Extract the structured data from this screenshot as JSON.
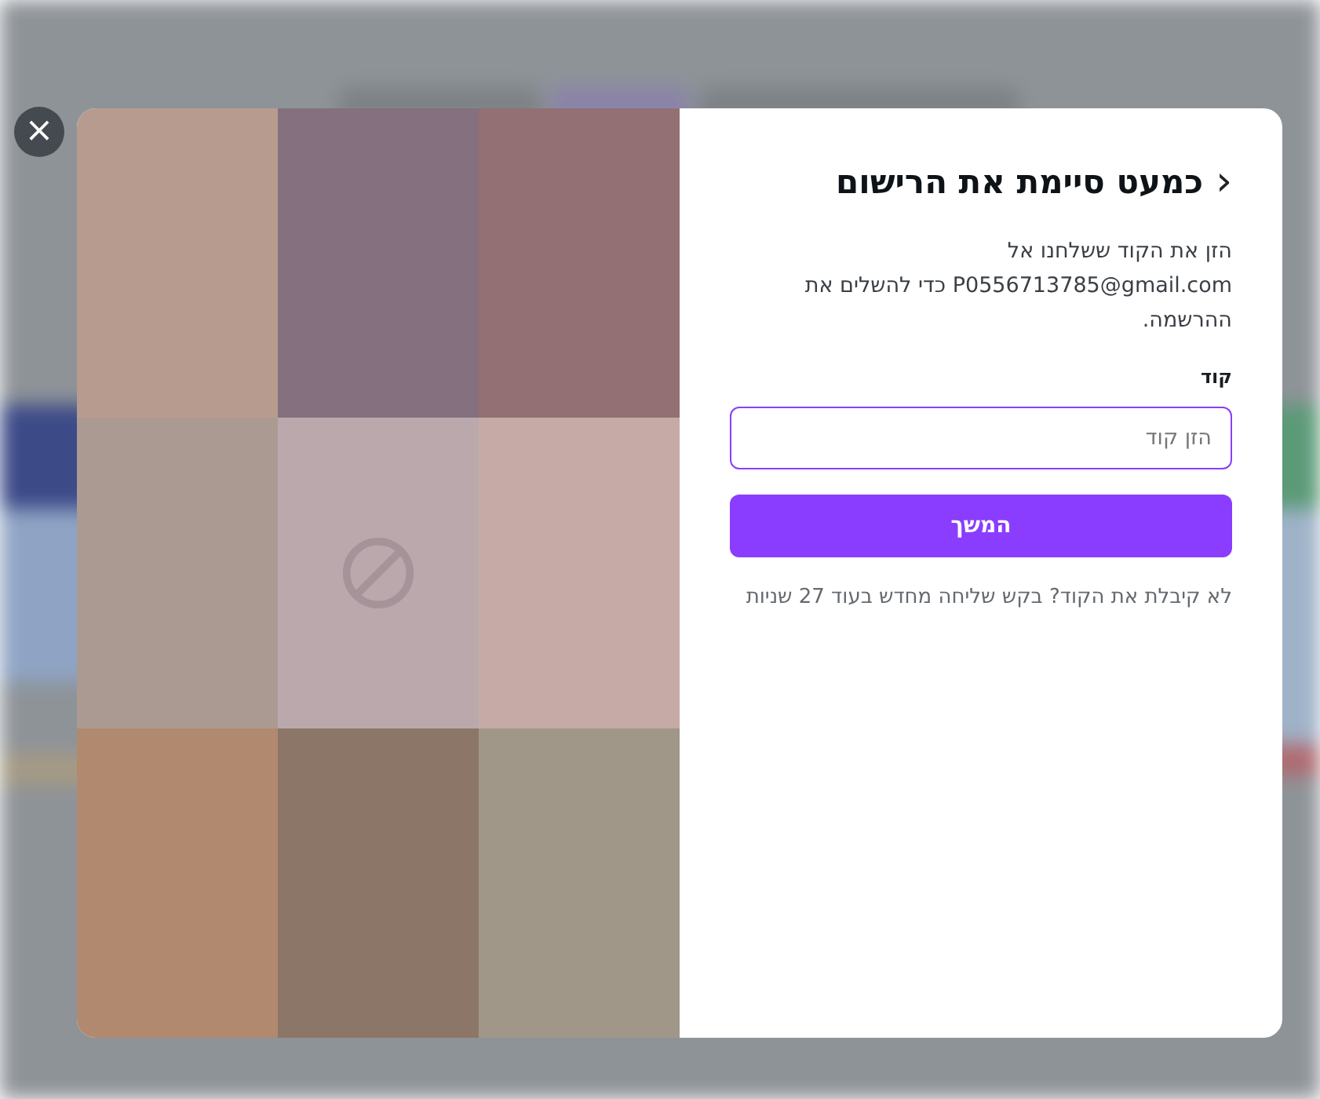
{
  "close_button": {
    "label": "×"
  },
  "tiles": [
    {
      "kind": "swatch",
      "color": "#b89b8f"
    },
    {
      "kind": "swatch",
      "color": "#85707f"
    },
    {
      "kind": "swatch",
      "color": "#927074"
    },
    {
      "kind": "swatch",
      "color": "#ab9a92"
    },
    {
      "kind": "blocked",
      "color": "#bba8ad"
    },
    {
      "kind": "swatch",
      "color": "#c5aaa5"
    },
    {
      "kind": "swatch",
      "color": "#b0896e"
    },
    {
      "kind": "swatch",
      "color": "#8c7668"
    },
    {
      "kind": "swatch",
      "color": "#a09788"
    }
  ],
  "form": {
    "back": "‹",
    "title": "כמעט סיימת את הרישום",
    "instructions": "הזן את הקוד ששלחנו אל P0556713785@gmail.com כדי להשלים את ההרשמה.",
    "field_label": "קוד",
    "placeholder": "הזן קוד",
    "continue_button": "המשך",
    "resend_note": "לא קיבלת את הקוד? בקש שליחה מחדש בעוד 27 שניות"
  }
}
